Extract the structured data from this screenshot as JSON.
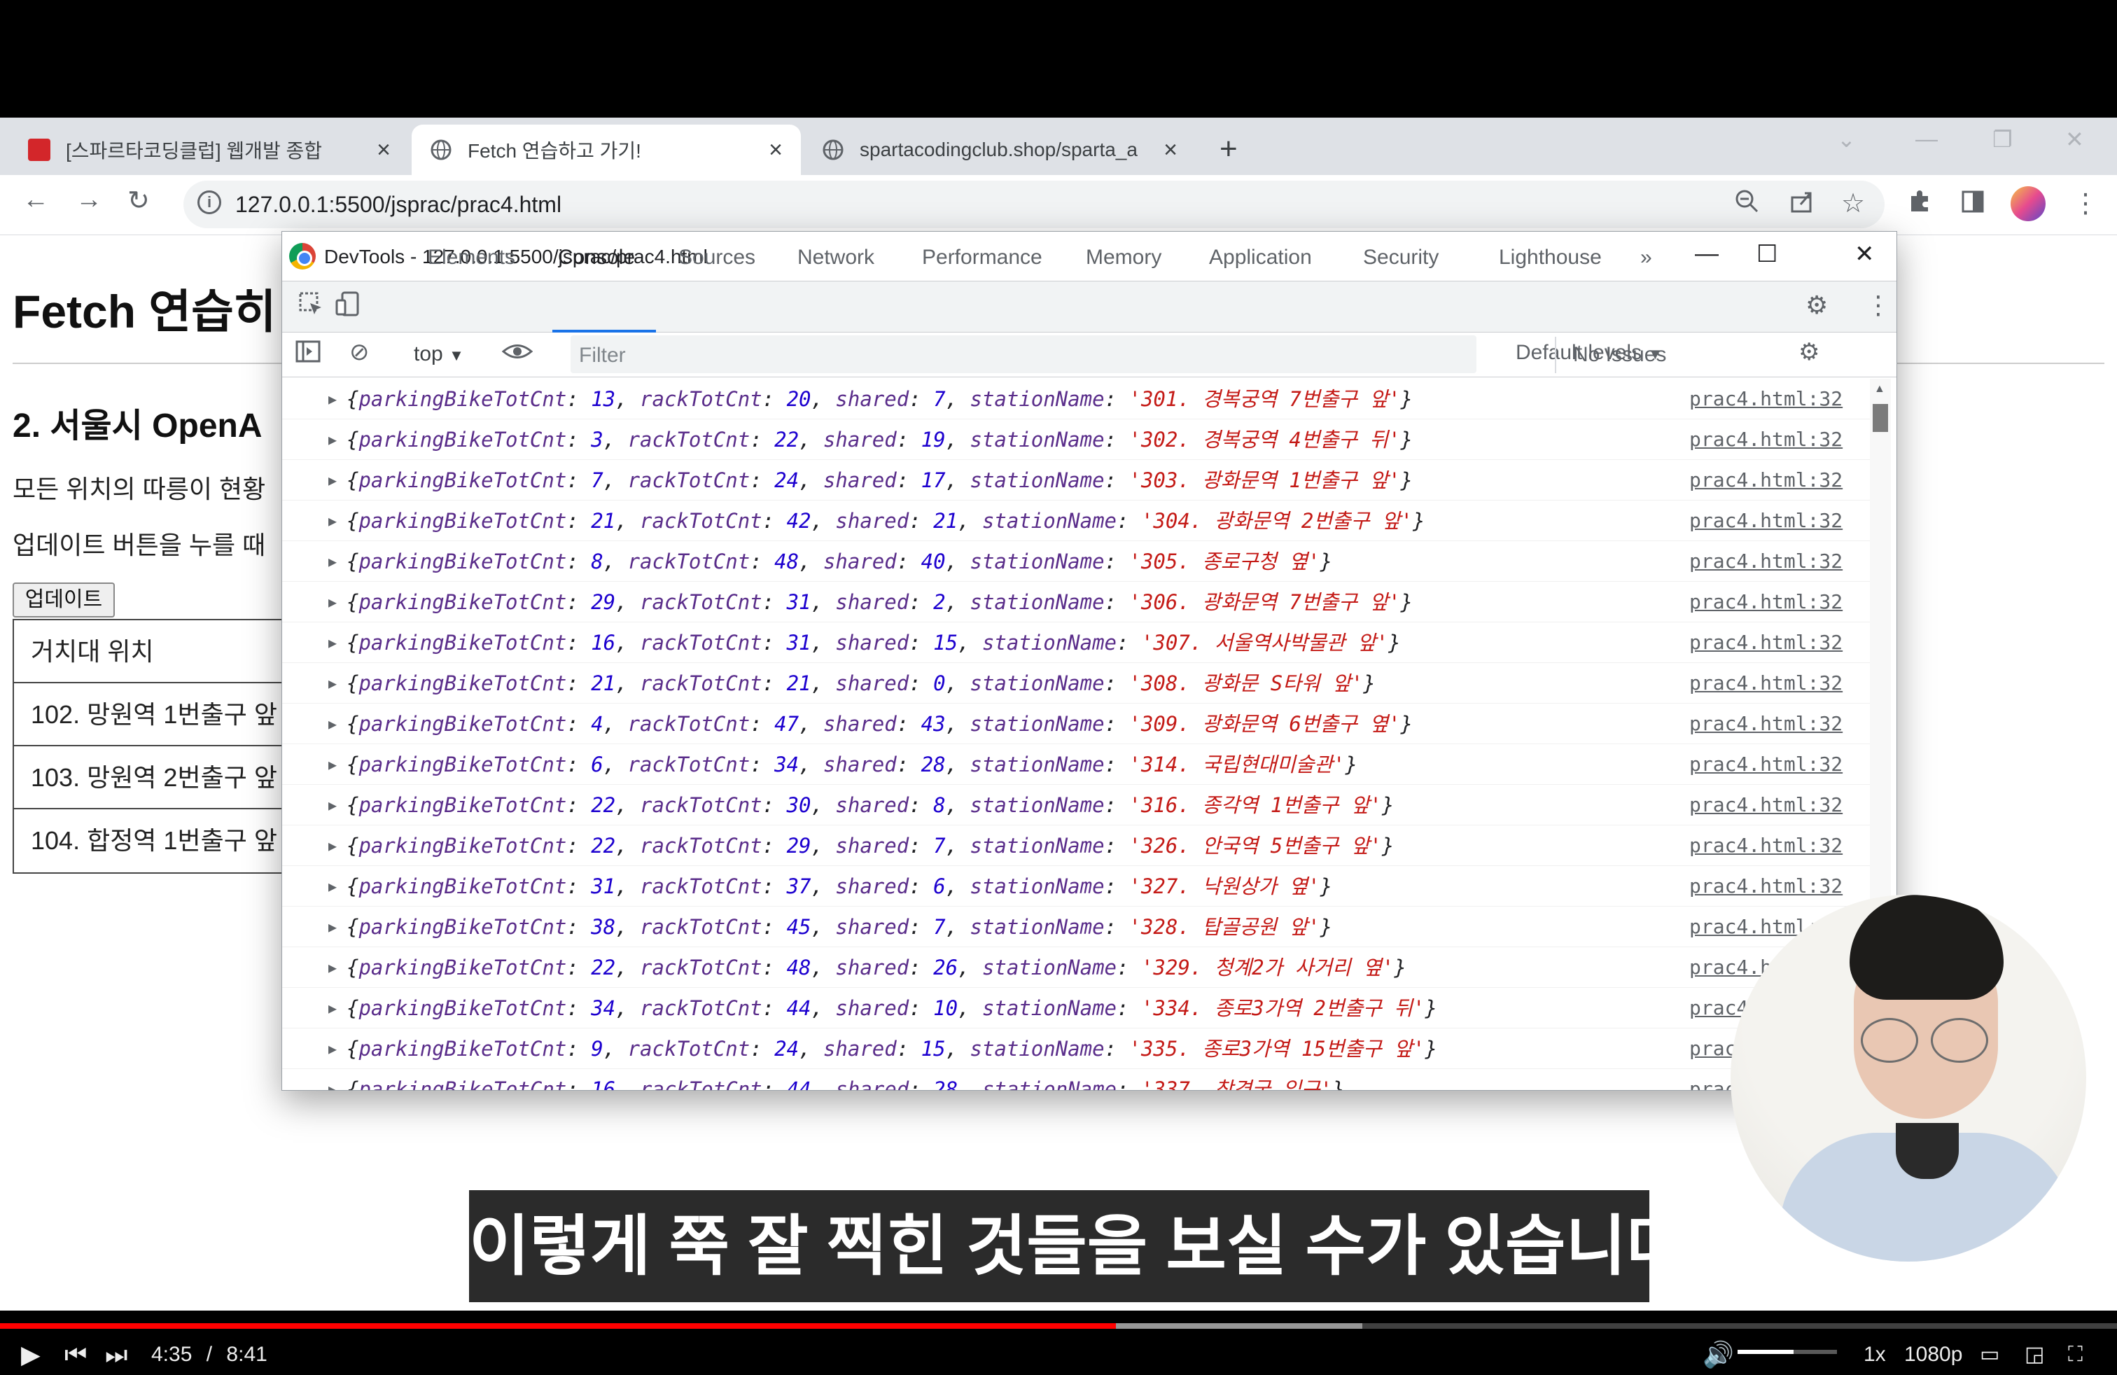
{
  "browser": {
    "tabs": [
      {
        "title": "[스파르타코딩클럽] 웹개발 종합",
        "active": false
      },
      {
        "title": "Fetch 연습하고 가기!",
        "active": true
      },
      {
        "title": "spartacodingclub.shop/sparta_a",
        "active": false
      }
    ],
    "url": "127.0.0.1:5500/jsprac/prac4.html"
  },
  "page": {
    "title": "Fetch 연습히",
    "subtitle": "2. 서울시 OpenA",
    "desc1": "모든 위치의 따릉이 현황",
    "desc2": "업데이트 버튼을 누를 때",
    "update_button": "업데이트",
    "table_rows": [
      "거치대 위치",
      "102. 망원역 1번출구 앞",
      "103. 망원역 2번출구 앞",
      "104. 합정역 1번출구 앞"
    ]
  },
  "devtools": {
    "title": "DevTools - 127.0.0.1:5500/jsprac/prac4.html",
    "tabs": [
      "Elements",
      "Console",
      "Sources",
      "Network",
      "Performance",
      "Memory",
      "Application",
      "Security",
      "Lighthouse"
    ],
    "active_tab": "Console",
    "more_tabs": "»",
    "context": "top",
    "filter_placeholder": "Filter",
    "levels": "Default levels",
    "issues": "No Issues",
    "logs": [
      {
        "p": "13",
        "r": "20",
        "s": "7",
        "n": "301. 경복궁역 7번출구 앞",
        "src": "prac4.html:32"
      },
      {
        "p": "3",
        "r": "22",
        "s": "19",
        "n": "302. 경복궁역 4번출구 뒤",
        "src": "prac4.html:32"
      },
      {
        "p": "7",
        "r": "24",
        "s": "17",
        "n": "303. 광화문역 1번출구 앞",
        "src": "prac4.html:32"
      },
      {
        "p": "21",
        "r": "42",
        "s": "21",
        "n": "304. 광화문역 2번출구 앞",
        "src": "prac4.html:32"
      },
      {
        "p": "8",
        "r": "48",
        "s": "40",
        "n": "305. 종로구청 옆",
        "src": "prac4.html:32"
      },
      {
        "p": "29",
        "r": "31",
        "s": "2",
        "n": "306. 광화문역 7번출구 앞",
        "src": "prac4.html:32"
      },
      {
        "p": "16",
        "r": "31",
        "s": "15",
        "n": "307. 서울역사박물관 앞",
        "src": "prac4.html:32"
      },
      {
        "p": "21",
        "r": "21",
        "s": "0",
        "n": "308. 광화문 S타워 앞",
        "src": "prac4.html:32"
      },
      {
        "p": "4",
        "r": "47",
        "s": "43",
        "n": "309. 광화문역 6번출구 옆",
        "src": "prac4.html:32"
      },
      {
        "p": "6",
        "r": "34",
        "s": "28",
        "n": "314. 국립현대미술관",
        "src": "prac4.html:32"
      },
      {
        "p": "22",
        "r": "30",
        "s": "8",
        "n": "316. 종각역 1번출구 앞",
        "src": "prac4.html:32"
      },
      {
        "p": "22",
        "r": "29",
        "s": "7",
        "n": "326. 안국역 5번출구 앞",
        "src": "prac4.html:32"
      },
      {
        "p": "31",
        "r": "37",
        "s": "6",
        "n": "327. 낙원상가 옆",
        "src": "prac4.html:32"
      },
      {
        "p": "38",
        "r": "45",
        "s": "7",
        "n": "328. 탑골공원 앞",
        "src": "prac4.html:3"
      },
      {
        "p": "22",
        "r": "48",
        "s": "26",
        "n": "329. 청계2가 사거리 옆",
        "src": "prac4.htm"
      },
      {
        "p": "34",
        "r": "44",
        "s": "10",
        "n": "334. 종로3가역 2번출구 뒤",
        "src": "prac4.h"
      },
      {
        "p": "9",
        "r": "24",
        "s": "15",
        "n": "335. 종로3가역 15번출구 앞",
        "src": "prac4"
      },
      {
        "p": "16",
        "r": "44",
        "s": "28",
        "n": "337. 창경궁 입구",
        "src": "prac4"
      }
    ]
  },
  "subtitle": "이렇게 쭉 잘 찍힌 것들을 보실 수가 있습니다",
  "player": {
    "time_current": "4:35",
    "time_separator": "/",
    "time_total": "8:41",
    "progress": 0.527,
    "speed": "1x",
    "quality": "1080p"
  },
  "colors": {
    "accent_blue": "#1a73e8",
    "progress_red": "#ff0000",
    "string_red": "#c41a16",
    "number_blue": "#1c00cf"
  }
}
